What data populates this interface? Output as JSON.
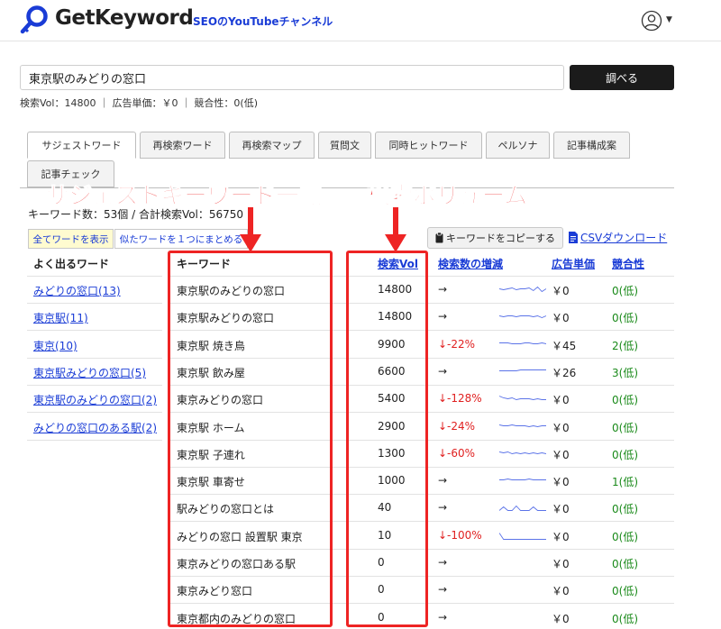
{
  "header": {
    "logo_text": "GetKeyword",
    "youtube_link": "SEOのYouTubeチャンネル",
    "logo_icon": "key-search-icon",
    "user_icon": "user-circle-icon"
  },
  "search": {
    "value": "東京駅のみどりの窓口",
    "button_label": "調べる",
    "stats": "検索Vol：14800 ｜ 広告単価：￥0 ｜ 競合性：0(低)"
  },
  "tabs": [
    {
      "label": "サジェストワード",
      "active": true
    },
    {
      "label": "再検索ワード"
    },
    {
      "label": "再検索マップ"
    },
    {
      "label": "質問文"
    },
    {
      "label": "同時ヒットワード"
    },
    {
      "label": "ペルソナ"
    },
    {
      "label": "記事構成案"
    },
    {
      "label": "記事チェック"
    }
  ],
  "summary": "キーワード数：53個 / 合計検索Vol：56750",
  "buttons": {
    "show_all": "全てワードを表示",
    "group_similar": "似たワードを１つにまとめる",
    "copy": "キーワードをコピーする",
    "csv": "CSVダウンロード"
  },
  "frequent_words": {
    "header": "よく出るワード",
    "items": [
      "みどりの窓口(13)",
      "東京駅(11)",
      "東京(10)",
      "東京駅みどりの窓口(5)",
      "東京駅のみどりの窓口(2)",
      "みどりの窓口のある駅(2)"
    ]
  },
  "table": {
    "columns": {
      "keyword": "キーワード",
      "volume": "検索Vol",
      "trend": "検索数の増減",
      "cpc": "広告単価",
      "competition": "競合性"
    },
    "rows": [
      {
        "keyword": "東京駅のみどりの窓口",
        "volume": "14800",
        "trend": "→",
        "spark": [
          5,
          6,
          5,
          4,
          6,
          5,
          5,
          4,
          7,
          3,
          8,
          5
        ],
        "cpc": "￥0",
        "competition": "0(低)"
      },
      {
        "keyword": "東京駅みどりの窓口",
        "volume": "14800",
        "trend": "→",
        "spark": [
          5,
          6,
          5,
          5,
          6,
          5,
          5,
          5,
          6,
          5,
          7,
          5
        ],
        "cpc": "￥0",
        "competition": "0(低)"
      },
      {
        "keyword": "東京駅 焼き鳥",
        "volume": "9900",
        "trend": "↓-22%",
        "spark": [
          4,
          4,
          4,
          5,
          5,
          5,
          4,
          4,
          5,
          5,
          4,
          5
        ],
        "cpc": "￥45",
        "competition": "2(低)"
      },
      {
        "keyword": "東京駅 飲み屋",
        "volume": "6600",
        "trend": "→",
        "spark": [
          5,
          5,
          5,
          5,
          5,
          4,
          4,
          4,
          4,
          4,
          4,
          4
        ],
        "cpc": "￥26",
        "competition": "3(低)"
      },
      {
        "keyword": "東京みどりの窓口",
        "volume": "5400",
        "trend": "↓-128%",
        "spark": [
          3,
          5,
          6,
          5,
          7,
          6,
          6,
          6,
          7,
          6,
          7,
          7
        ],
        "cpc": "￥0",
        "competition": "0(低)"
      },
      {
        "keyword": "東京駅 ホーム",
        "volume": "2900",
        "trend": "↓-24%",
        "spark": [
          4,
          5,
          5,
          4,
          5,
          5,
          5,
          6,
          5,
          6,
          5,
          5
        ],
        "cpc": "￥0",
        "competition": "0(低)"
      },
      {
        "keyword": "東京駅 子連れ",
        "volume": "1300",
        "trend": "↓-60%",
        "spark": [
          4,
          5,
          4,
          6,
          5,
          6,
          5,
          6,
          5,
          6,
          5,
          6
        ],
        "cpc": "￥0",
        "competition": "0(低)"
      },
      {
        "keyword": "東京駅 車寄せ",
        "volume": "1000",
        "trend": "→",
        "spark": [
          5,
          5,
          4,
          5,
          5,
          5,
          5,
          4,
          5,
          5,
          5,
          5
        ],
        "cpc": "￥0",
        "competition": "1(低)"
      },
      {
        "keyword": "駅みどりの窓口とは",
        "volume": "40",
        "trend": "→",
        "spark": [
          9,
          5,
          9,
          9,
          4,
          9,
          9,
          9,
          5,
          9,
          9,
          9
        ],
        "cpc": "￥0",
        "competition": "0(低)"
      },
      {
        "keyword": "みどりの窓口 設置駅 東京",
        "volume": "10",
        "trend": "↓-100%",
        "spark": [
          3,
          10,
          10,
          10,
          10,
          10,
          10,
          10,
          10,
          10,
          10,
          10
        ],
        "cpc": "￥0",
        "competition": "0(低)"
      },
      {
        "keyword": "東京みどりの窓口ある駅",
        "volume": "0",
        "trend": "→",
        "spark": [],
        "cpc": "￥0",
        "competition": "0(低)"
      },
      {
        "keyword": "東京みどり窓口",
        "volume": "0",
        "trend": "→",
        "spark": [],
        "cpc": "￥0",
        "competition": "0(低)"
      },
      {
        "keyword": "東京都内のみどりの窓口",
        "volume": "0",
        "trend": "→",
        "spark": [],
        "cpc": "￥0",
        "competition": "0(低)"
      }
    ]
  },
  "annotations": {
    "suggest_label": "サジェストキーワード一覧",
    "volume_label": "検索ボリューム",
    "color": "#ee2424"
  },
  "colors": {
    "link": "#1a3cd6",
    "decrease": "#e02020",
    "low_competition": "#1a8a1a",
    "highlight_button": "#fffbd0",
    "search_button": "#1b1b1b"
  }
}
